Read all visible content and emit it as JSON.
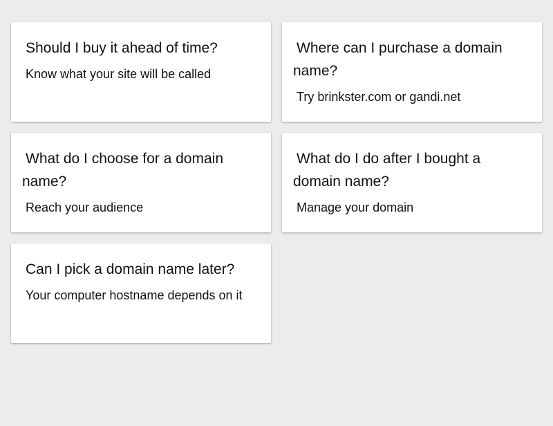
{
  "cards": [
    {
      "question": "Should I buy it ahead of time?",
      "answer": "Know what your site will be called"
    },
    {
      "question": "Where can I purchase a domain name?",
      "answer": "Try brinkster.com or gandi.net"
    },
    {
      "question": "What do I choose for a domain name?",
      "answer": "Reach your audience"
    },
    {
      "question": "What do I do after I bought a domain name?",
      "answer": "Manage your domain"
    },
    {
      "question": "Can I pick a domain name later?",
      "answer": "Your computer hostname depends on it"
    }
  ]
}
